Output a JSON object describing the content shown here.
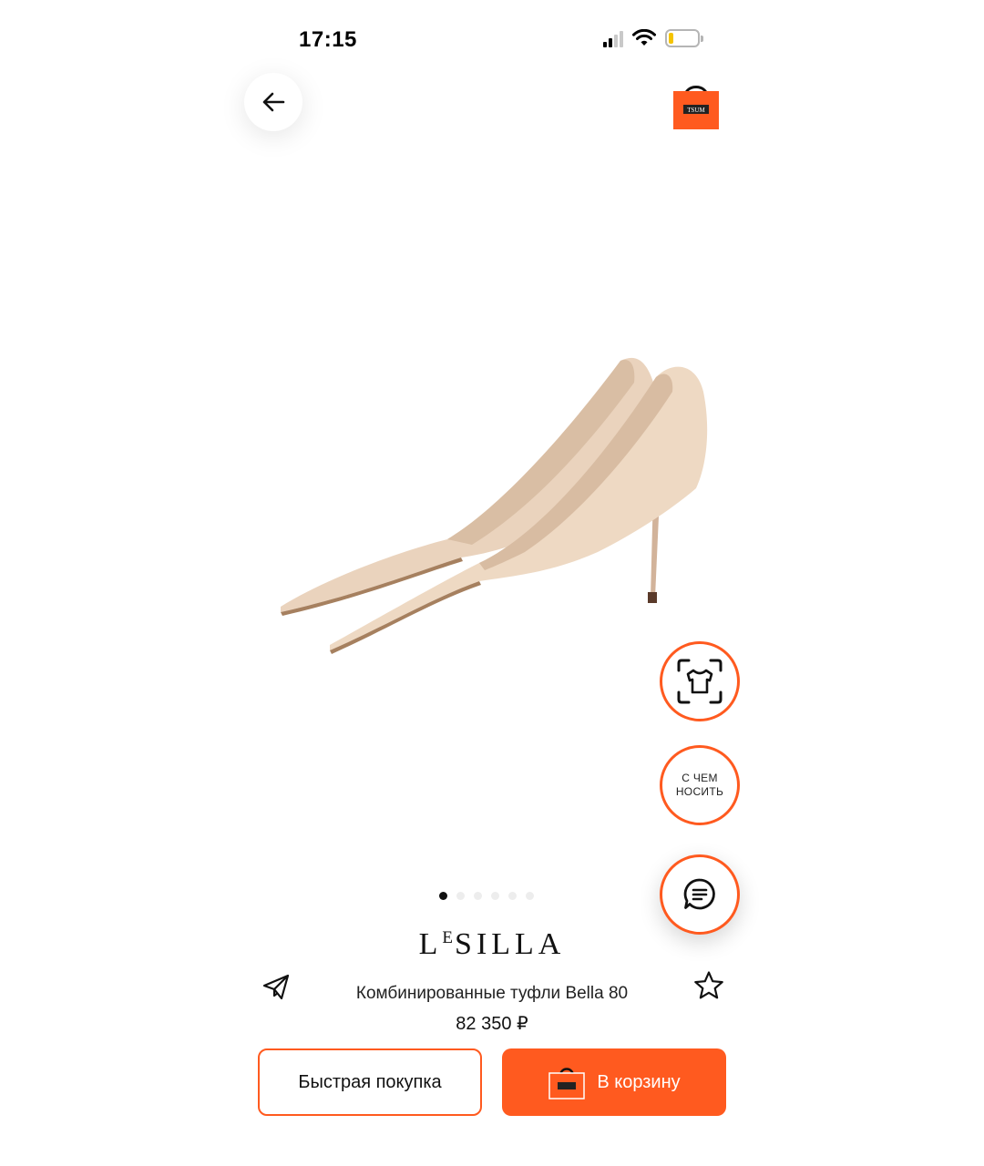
{
  "status_bar": {
    "time": "17:15",
    "battery_level": 0.15,
    "battery_color": "#f5c400"
  },
  "header": {
    "back_icon": "arrow-left-icon",
    "cart_icon": "shopping-bag-icon",
    "cart_logo_text": "TSUM"
  },
  "gallery": {
    "image": "beige-pointed-pumps",
    "total_images": 6,
    "active_index": 0
  },
  "floating_actions": {
    "try_on_icon": "tshirt-scan-icon",
    "wear_with_line1": "С ЧЕМ",
    "wear_with_line2": "НОСИТЬ",
    "chat_icon": "chat-bubble-icon"
  },
  "product": {
    "brand_first": "L",
    "brand_super": "E",
    "brand_rest": "SILLA",
    "name": "Комбинированные туфли Bella 80",
    "price": "82 350 ₽",
    "share_icon": "paper-plane-icon",
    "favorite_icon": "star-outline-icon"
  },
  "actions": {
    "quick_buy_label": "Быстрая покупка",
    "add_to_cart_label": "В корзину",
    "add_to_cart_icon": "shopping-bag-icon"
  },
  "colors": {
    "accent": "#ff5a1f",
    "product_beige": "#ead2bb"
  }
}
